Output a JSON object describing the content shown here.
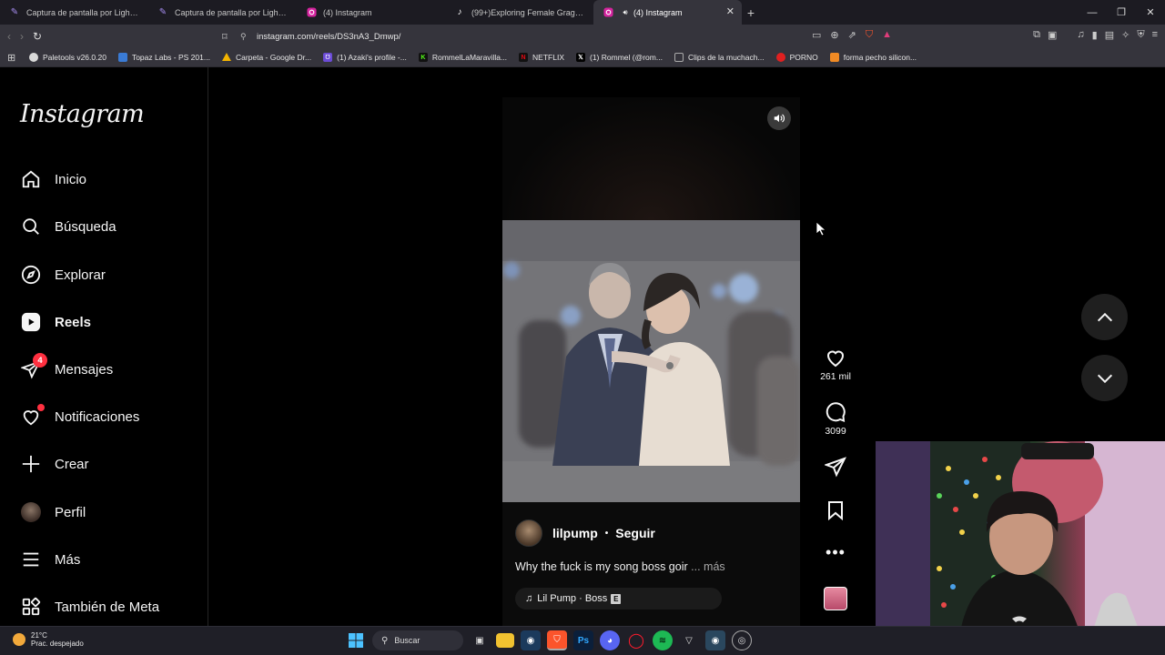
{
  "browser": {
    "tabs": [
      {
        "label": "Captura de pantalla por Lightshot",
        "icon": "lightshot-feather-icon"
      },
      {
        "label": "Captura de pantalla por Lightshot",
        "icon": "lightshot-feather-icon"
      },
      {
        "label": "(4) Instagram",
        "icon": "instagram-icon"
      },
      {
        "label": "(99+)Exploring Female Gragas Cosp",
        "icon": "tiktok-icon"
      },
      {
        "label": "(4) Instagram",
        "icon": "instagram-icon",
        "active": true
      }
    ],
    "url": "instagram.com/reels/DS3nA3_Dmwp/",
    "bookmarks": [
      {
        "label": "Paletools v26.0.20",
        "color": "#d9d9d9"
      },
      {
        "label": "Topaz Labs - PS 201...",
        "color": "#3a7bd5"
      },
      {
        "label": "Carpeta - Google Dr...",
        "color": "#f4b400"
      },
      {
        "label": "(1) Azaki's profile -...",
        "color": "#6b4bd6"
      },
      {
        "label": "RommelLaMaravilla...",
        "color": "#53fc18"
      },
      {
        "label": "NETFLIX",
        "color": "#111111"
      },
      {
        "label": "(1) Rommel (@rom...",
        "color": "#000000"
      },
      {
        "label": "Clips de la muchach...",
        "color": "#ffffff"
      },
      {
        "label": "PORNO",
        "color": "#e02020"
      },
      {
        "label": "forma pecho silicon...",
        "color": "#f08a24"
      }
    ]
  },
  "instagram": {
    "logo": "Instagram",
    "nav": [
      {
        "label": "Inicio",
        "icon": "home-icon"
      },
      {
        "label": "Búsqueda",
        "icon": "search-icon"
      },
      {
        "label": "Explorar",
        "icon": "compass-icon"
      },
      {
        "label": "Reels",
        "icon": "reels-icon",
        "active": true
      },
      {
        "label": "Mensajes",
        "icon": "messenger-icon",
        "badge": "4"
      },
      {
        "label": "Notificaciones",
        "icon": "heart-icon"
      },
      {
        "label": "Crear",
        "icon": "plus-icon"
      },
      {
        "label": "Perfil",
        "icon": "profile-avatar"
      },
      {
        "label": "Más",
        "icon": "menu-icon"
      },
      {
        "label": "También de Meta",
        "icon": "meta-grid-icon"
      }
    ],
    "reel": {
      "username": "lilpump",
      "separator": "•",
      "follow": "Seguir",
      "caption": "Why the fuck is my song boss goir",
      "more": "... más",
      "audio": "Lil Pump · Boss",
      "explicit": "E",
      "likes": "261 mil",
      "comments": "3099"
    }
  },
  "taskbar": {
    "temperature": "21°C",
    "weather": "Prac. despejado",
    "search_placeholder": "Buscar"
  }
}
